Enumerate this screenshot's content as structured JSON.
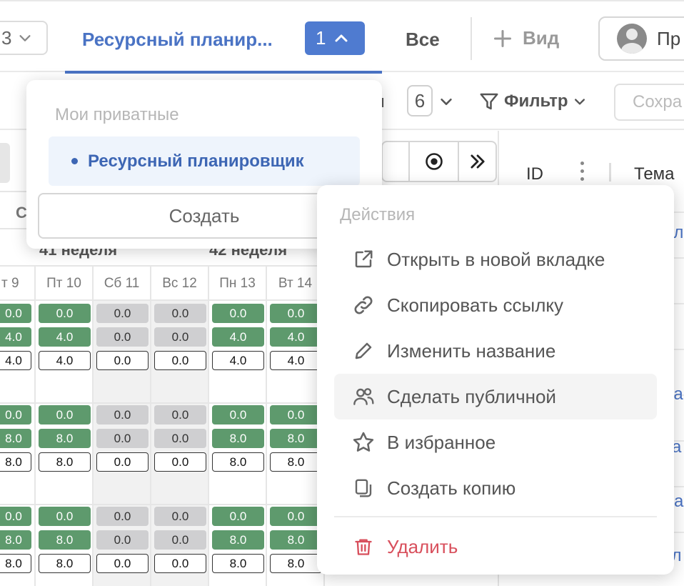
{
  "tabs": {
    "view_select_value": "3",
    "active_label": "Ресурсный планир...",
    "active_count": "1",
    "all_label": "Все",
    "add_view_label": "Вид",
    "user_label": "Пр"
  },
  "toolbar": {
    "columns_label_partial": "ки",
    "columns_count": "6",
    "filter_label": "Фильтр",
    "save_label": "Сохра"
  },
  "grid": {
    "sub_partial": "С",
    "weeks": [
      "41 неделя",
      "42 неделя"
    ],
    "days": [
      "т 9",
      "Пт 10",
      "Сб 11",
      "Вс 12",
      "Пн 13",
      "Вт 14"
    ],
    "groups": [
      {
        "rows": [
          [
            "0.0",
            "0.0",
            "0.0",
            "0.0",
            "0.0",
            "0.0"
          ],
          [
            "4.0",
            "4.0",
            "0.0",
            "0.0",
            "4.0",
            "4.0"
          ],
          [
            "4.0",
            "4.0",
            "0.0",
            "0.0",
            "4.0",
            "4.0"
          ]
        ]
      },
      {
        "rows": [
          [
            "0.0",
            "0.0",
            "0.0",
            "0.0",
            "0.0",
            "0.0"
          ],
          [
            "8.0",
            "8.0",
            "0.0",
            "0.0",
            "8.0",
            "8.0"
          ],
          [
            "8.0",
            "8.0",
            "0.0",
            "0.0",
            "8.0",
            "8.0"
          ]
        ]
      },
      {
        "rows": [
          [
            "0.0",
            "0.0",
            "0.0",
            "0.0",
            "0.0",
            "0.0"
          ],
          [
            "8.0",
            "8.0",
            "0.0",
            "0.0",
            "8.0",
            "8.0"
          ],
          [
            "8.0",
            "8.0",
            "0.0",
            "0.0",
            "8.0",
            "8.0"
          ]
        ]
      }
    ]
  },
  "right_table": {
    "id_header": "ID",
    "tema_header": "Тема",
    "row_fragments": [
      "ал",
      "н",
      "н",
      "ра",
      "за",
      "да",
      "тл"
    ]
  },
  "views_popup": {
    "section_label": "Мои приватные",
    "item_label": "Ресурсный планировщик",
    "create_label": "Создать"
  },
  "actions_popup": {
    "title": "Действия",
    "items": [
      {
        "label": "Открыть в новой вкладке",
        "icon": "external-link-icon"
      },
      {
        "label": "Скопировать ссылку",
        "icon": "link-icon"
      },
      {
        "label": "Изменить название",
        "icon": "pencil-icon"
      },
      {
        "label": "Сделать публичной",
        "icon": "users-icon"
      },
      {
        "label": "В избранное",
        "icon": "star-icon"
      },
      {
        "label": "Создать копию",
        "icon": "copy-icon"
      }
    ],
    "delete_label": "Удалить",
    "delete_icon": "trash-icon"
  },
  "colors": {
    "accent": "#4a73c4",
    "green_cell": "#5e9a6d",
    "gray_cell": "#cfcfd1",
    "danger": "#d84f5c"
  }
}
